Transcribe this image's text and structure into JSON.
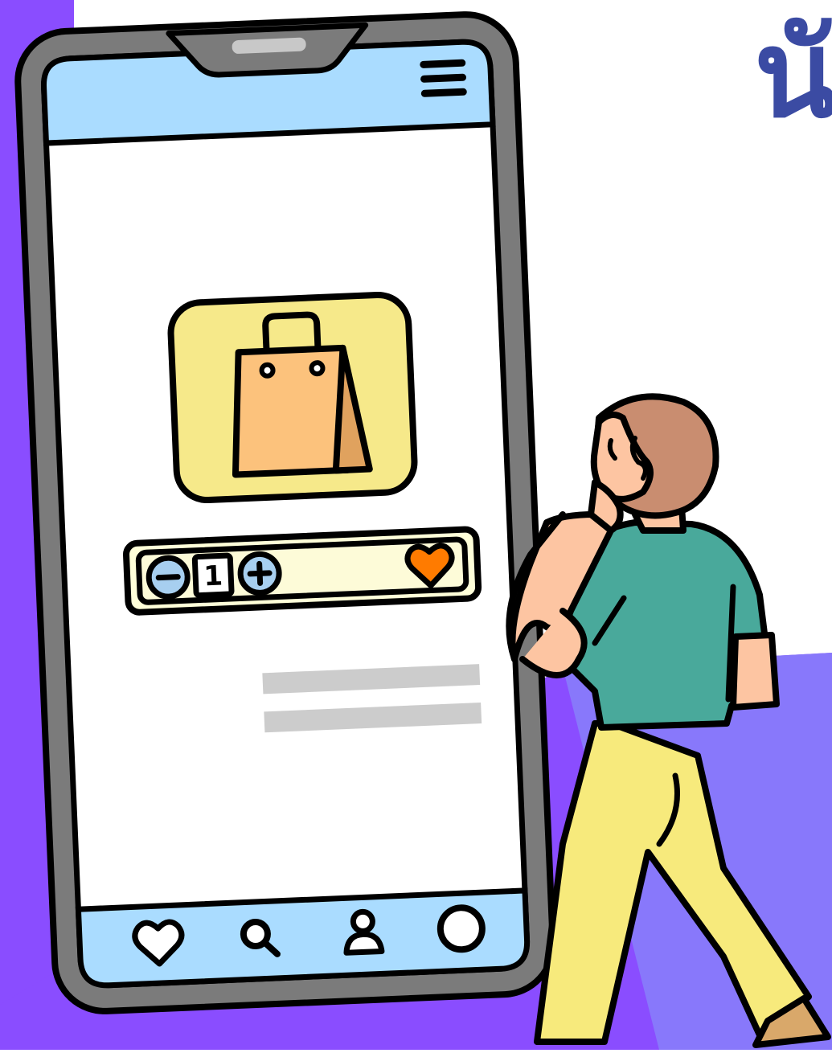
{
  "heading": {
    "text": "นั"
  },
  "product": {
    "quantity": "1",
    "favorited": true
  },
  "quantity_stepper": {
    "decrement_icon": "minus-circle-icon",
    "increment_icon": "plus-circle-icon"
  },
  "bottom_nav": {
    "items": [
      {
        "icon": "heart-icon"
      },
      {
        "icon": "search-icon"
      },
      {
        "icon": "user-icon"
      },
      {
        "icon": "circle-icon"
      }
    ]
  },
  "colors": {
    "purple": "#8a4dff",
    "heading": "#3b4ba3",
    "screen_bar": "#aadcff",
    "card_yellow": "#f6e98a",
    "bag_orange": "#fcc27c",
    "heart_orange": "#ff7b00",
    "shirt": "#49a99b",
    "pants": "#f7ea7c",
    "skin": "#fdc5a2",
    "hair": "#c98d70"
  }
}
